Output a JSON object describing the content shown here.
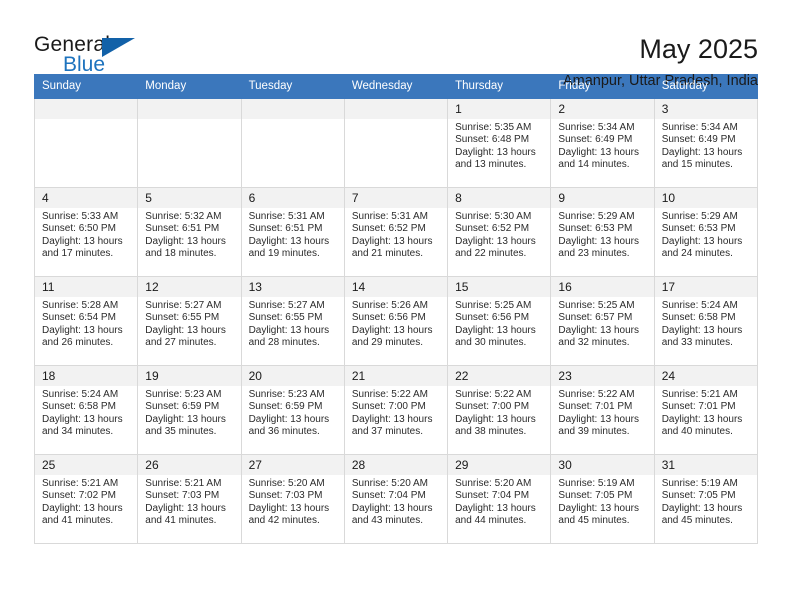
{
  "logo": {
    "text_primary": "General",
    "text_secondary": "Blue",
    "triangle_color": "#1261a8",
    "accent_color": "#1e73be"
  },
  "header": {
    "title": "May 2025",
    "subtitle": "Amanpur, Uttar Pradesh, India"
  },
  "theme": {
    "header_row_bg": "#3b77bc",
    "daynum_bg": "#f2f2f2",
    "grid_border": "#d9d9d9"
  },
  "calendar": {
    "weekday_headers": [
      "Sunday",
      "Monday",
      "Tuesday",
      "Wednesday",
      "Thursday",
      "Friday",
      "Saturday"
    ],
    "weeks": [
      [
        {
          "day": "",
          "empty": true
        },
        {
          "day": "",
          "empty": true
        },
        {
          "day": "",
          "empty": true
        },
        {
          "day": "",
          "empty": true
        },
        {
          "day": "1",
          "sunrise": "Sunrise: 5:35 AM",
          "sunset": "Sunset: 6:48 PM",
          "daylight": "Daylight: 13 hours and 13 minutes."
        },
        {
          "day": "2",
          "sunrise": "Sunrise: 5:34 AM",
          "sunset": "Sunset: 6:49 PM",
          "daylight": "Daylight: 13 hours and 14 minutes."
        },
        {
          "day": "3",
          "sunrise": "Sunrise: 5:34 AM",
          "sunset": "Sunset: 6:49 PM",
          "daylight": "Daylight: 13 hours and 15 minutes."
        }
      ],
      [
        {
          "day": "4",
          "sunrise": "Sunrise: 5:33 AM",
          "sunset": "Sunset: 6:50 PM",
          "daylight": "Daylight: 13 hours and 17 minutes."
        },
        {
          "day": "5",
          "sunrise": "Sunrise: 5:32 AM",
          "sunset": "Sunset: 6:51 PM",
          "daylight": "Daylight: 13 hours and 18 minutes."
        },
        {
          "day": "6",
          "sunrise": "Sunrise: 5:31 AM",
          "sunset": "Sunset: 6:51 PM",
          "daylight": "Daylight: 13 hours and 19 minutes."
        },
        {
          "day": "7",
          "sunrise": "Sunrise: 5:31 AM",
          "sunset": "Sunset: 6:52 PM",
          "daylight": "Daylight: 13 hours and 21 minutes."
        },
        {
          "day": "8",
          "sunrise": "Sunrise: 5:30 AM",
          "sunset": "Sunset: 6:52 PM",
          "daylight": "Daylight: 13 hours and 22 minutes."
        },
        {
          "day": "9",
          "sunrise": "Sunrise: 5:29 AM",
          "sunset": "Sunset: 6:53 PM",
          "daylight": "Daylight: 13 hours and 23 minutes."
        },
        {
          "day": "10",
          "sunrise": "Sunrise: 5:29 AM",
          "sunset": "Sunset: 6:53 PM",
          "daylight": "Daylight: 13 hours and 24 minutes."
        }
      ],
      [
        {
          "day": "11",
          "sunrise": "Sunrise: 5:28 AM",
          "sunset": "Sunset: 6:54 PM",
          "daylight": "Daylight: 13 hours and 26 minutes."
        },
        {
          "day": "12",
          "sunrise": "Sunrise: 5:27 AM",
          "sunset": "Sunset: 6:55 PM",
          "daylight": "Daylight: 13 hours and 27 minutes."
        },
        {
          "day": "13",
          "sunrise": "Sunrise: 5:27 AM",
          "sunset": "Sunset: 6:55 PM",
          "daylight": "Daylight: 13 hours and 28 minutes."
        },
        {
          "day": "14",
          "sunrise": "Sunrise: 5:26 AM",
          "sunset": "Sunset: 6:56 PM",
          "daylight": "Daylight: 13 hours and 29 minutes."
        },
        {
          "day": "15",
          "sunrise": "Sunrise: 5:25 AM",
          "sunset": "Sunset: 6:56 PM",
          "daylight": "Daylight: 13 hours and 30 minutes."
        },
        {
          "day": "16",
          "sunrise": "Sunrise: 5:25 AM",
          "sunset": "Sunset: 6:57 PM",
          "daylight": "Daylight: 13 hours and 32 minutes."
        },
        {
          "day": "17",
          "sunrise": "Sunrise: 5:24 AM",
          "sunset": "Sunset: 6:58 PM",
          "daylight": "Daylight: 13 hours and 33 minutes."
        }
      ],
      [
        {
          "day": "18",
          "sunrise": "Sunrise: 5:24 AM",
          "sunset": "Sunset: 6:58 PM",
          "daylight": "Daylight: 13 hours and 34 minutes."
        },
        {
          "day": "19",
          "sunrise": "Sunrise: 5:23 AM",
          "sunset": "Sunset: 6:59 PM",
          "daylight": "Daylight: 13 hours and 35 minutes."
        },
        {
          "day": "20",
          "sunrise": "Sunrise: 5:23 AM",
          "sunset": "Sunset: 6:59 PM",
          "daylight": "Daylight: 13 hours and 36 minutes."
        },
        {
          "day": "21",
          "sunrise": "Sunrise: 5:22 AM",
          "sunset": "Sunset: 7:00 PM",
          "daylight": "Daylight: 13 hours and 37 minutes."
        },
        {
          "day": "22",
          "sunrise": "Sunrise: 5:22 AM",
          "sunset": "Sunset: 7:00 PM",
          "daylight": "Daylight: 13 hours and 38 minutes."
        },
        {
          "day": "23",
          "sunrise": "Sunrise: 5:22 AM",
          "sunset": "Sunset: 7:01 PM",
          "daylight": "Daylight: 13 hours and 39 minutes."
        },
        {
          "day": "24",
          "sunrise": "Sunrise: 5:21 AM",
          "sunset": "Sunset: 7:01 PM",
          "daylight": "Daylight: 13 hours and 40 minutes."
        }
      ],
      [
        {
          "day": "25",
          "sunrise": "Sunrise: 5:21 AM",
          "sunset": "Sunset: 7:02 PM",
          "daylight": "Daylight: 13 hours and 41 minutes."
        },
        {
          "day": "26",
          "sunrise": "Sunrise: 5:21 AM",
          "sunset": "Sunset: 7:03 PM",
          "daylight": "Daylight: 13 hours and 41 minutes."
        },
        {
          "day": "27",
          "sunrise": "Sunrise: 5:20 AM",
          "sunset": "Sunset: 7:03 PM",
          "daylight": "Daylight: 13 hours and 42 minutes."
        },
        {
          "day": "28",
          "sunrise": "Sunrise: 5:20 AM",
          "sunset": "Sunset: 7:04 PM",
          "daylight": "Daylight: 13 hours and 43 minutes."
        },
        {
          "day": "29",
          "sunrise": "Sunrise: 5:20 AM",
          "sunset": "Sunset: 7:04 PM",
          "daylight": "Daylight: 13 hours and 44 minutes."
        },
        {
          "day": "30",
          "sunrise": "Sunrise: 5:19 AM",
          "sunset": "Sunset: 7:05 PM",
          "daylight": "Daylight: 13 hours and 45 minutes."
        },
        {
          "day": "31",
          "sunrise": "Sunrise: 5:19 AM",
          "sunset": "Sunset: 7:05 PM",
          "daylight": "Daylight: 13 hours and 45 minutes."
        }
      ]
    ]
  }
}
